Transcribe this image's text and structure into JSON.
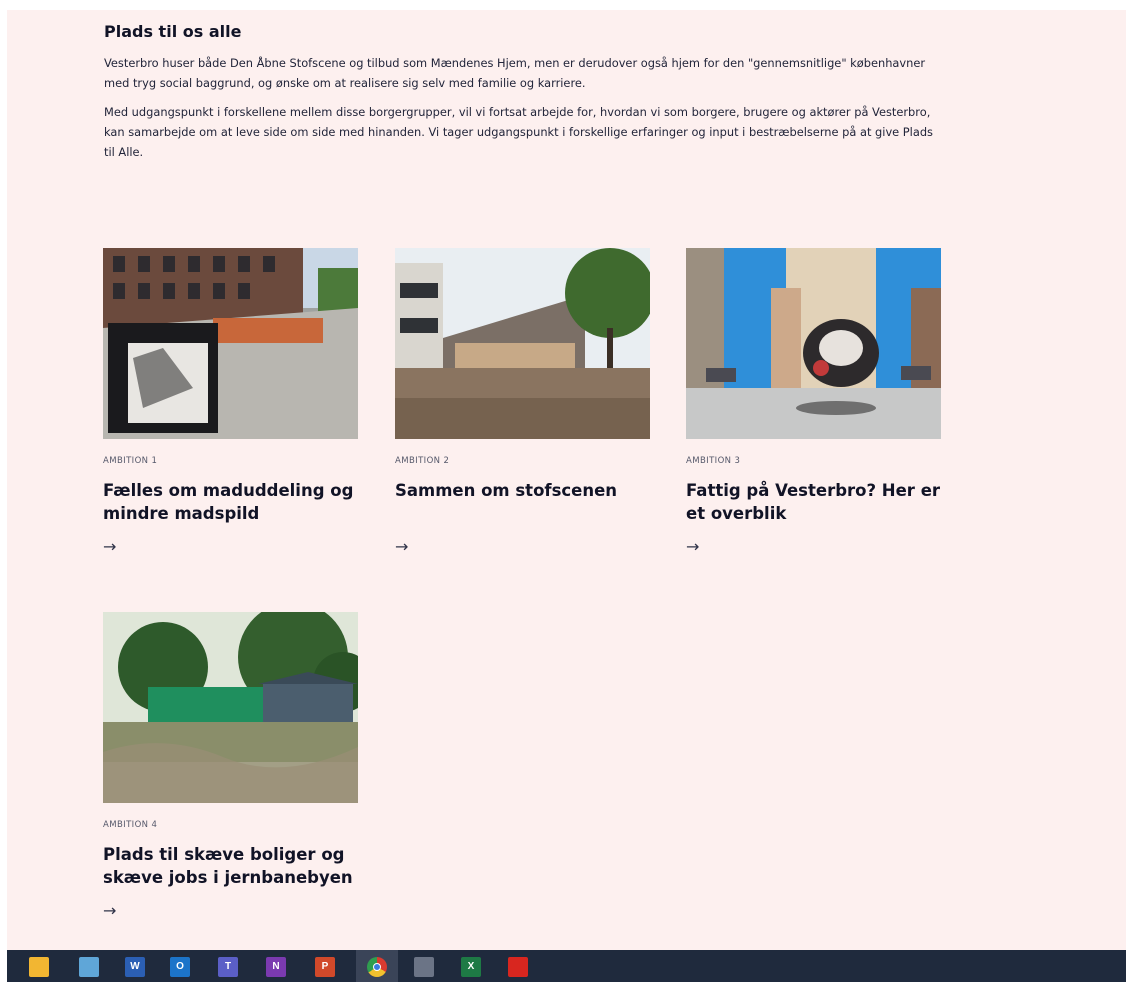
{
  "intro": {
    "title": "Plads til os alle",
    "paragraph1": "Vesterbro huser både Den Åbne Stofscene og tilbud som Mændenes Hjem, men er derudover også hjem for den \"gennemsnitlige\" københavner med tryg social baggrund, og ønske om at realisere sig selv med familie og karriere.",
    "paragraph2": "Med udgangspunkt i forskellene mellem disse borgergrupper, vil vi fortsat arbejde for, hvordan vi som borgere, brugere og aktører på Vesterbro, kan samarbejde om at leve side om side med hinanden. Vi tager udgangspunkt i forskellige erfaringer og input i bestræbelserne på at give Plads til Alle."
  },
  "cards": [
    {
      "kicker": "AMBITION 1",
      "title": "Fælles om maduddeling og mindre madspild",
      "arrow": "→"
    },
    {
      "kicker": "AMBITION 2",
      "title": "Sammen om stofscenen",
      "arrow": "→"
    },
    {
      "kicker": "AMBITION 3",
      "title": "Fattig på Vesterbro? Her er et overblik",
      "arrow": "→"
    },
    {
      "kicker": "AMBITION 4",
      "title": "Plads til skæve boliger og skæve jobs i jernbanebyen",
      "arrow": "→"
    }
  ],
  "taskbar": {
    "icons": [
      {
        "name": "file-explorer-icon",
        "label": "",
        "color": "#f2b632"
      },
      {
        "name": "notepad-icon",
        "label": "",
        "color": "#5fa6d8"
      },
      {
        "name": "word-icon",
        "label": "W",
        "color": "#2b5fb4"
      },
      {
        "name": "outlook-icon",
        "label": "O",
        "color": "#1c74c9"
      },
      {
        "name": "teams-icon",
        "label": "T",
        "color": "#5b5fc7"
      },
      {
        "name": "onenote-icon",
        "label": "N",
        "color": "#7b3ab0"
      },
      {
        "name": "powerpoint-icon",
        "label": "P",
        "color": "#d1492a"
      },
      {
        "name": "chrome-icon",
        "label": "",
        "color": "#e0b12d"
      },
      {
        "name": "calculator-icon",
        "label": "",
        "color": "#6b7486"
      },
      {
        "name": "excel-icon",
        "label": "X",
        "color": "#1e7a45"
      },
      {
        "name": "acrobat-icon",
        "label": "",
        "color": "#d8261f"
      }
    ]
  }
}
